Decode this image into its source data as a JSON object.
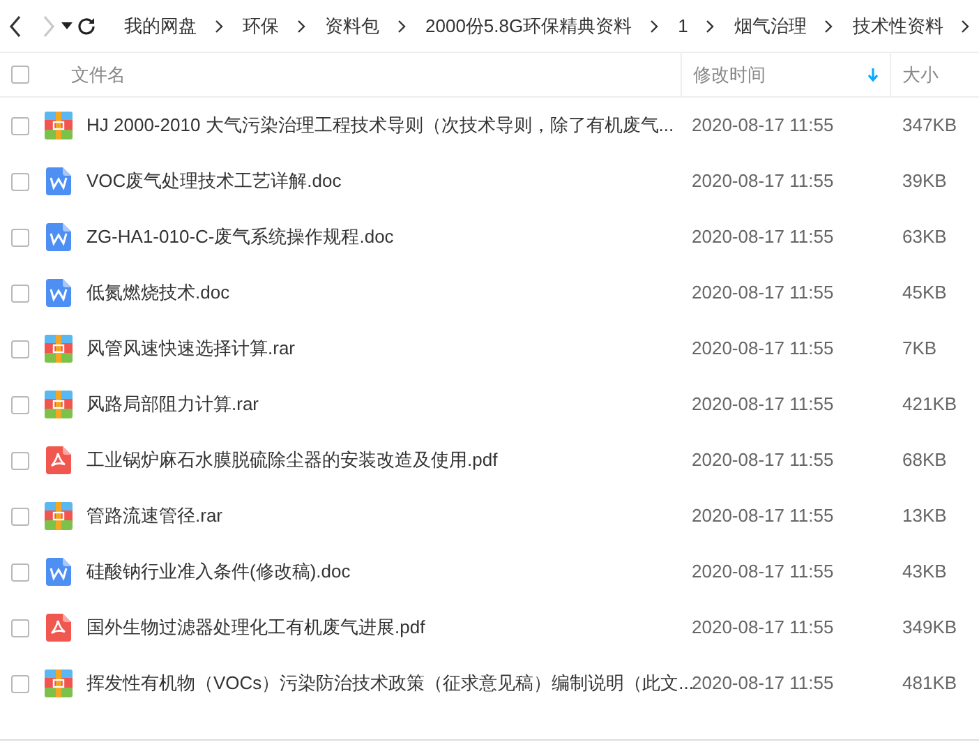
{
  "toolbar": {
    "back_enabled": true,
    "forward_enabled": false,
    "breadcrumb": [
      "我的网盘",
      "环保",
      "资料包",
      "2000份5.8G环保精典资料",
      "1",
      "烟气治理",
      "技术性资料"
    ]
  },
  "table": {
    "select_all_checked": false,
    "columns": [
      {
        "label": "文件名",
        "sorted": false
      },
      {
        "label": "修改时间",
        "sorted": true
      },
      {
        "label": "大小",
        "sorted": false
      }
    ],
    "rows": [
      {
        "kind": "rar",
        "name": "HJ 2000-2010 大气污染治理工程技术导则（次技术导则，除了有机废气...",
        "modified": "2020-08-17 11:55",
        "size": "347KB",
        "checked": false
      },
      {
        "kind": "doc",
        "name": "VOC废气处理技术工艺详解.doc",
        "modified": "2020-08-17 11:55",
        "size": "39KB",
        "checked": false
      },
      {
        "kind": "doc",
        "name": "ZG-HA1-010-C-废气系统操作规程.doc",
        "modified": "2020-08-17 11:55",
        "size": "63KB",
        "checked": false
      },
      {
        "kind": "doc",
        "name": "低氮燃烧技术.doc",
        "modified": "2020-08-17 11:55",
        "size": "45KB",
        "checked": false
      },
      {
        "kind": "rar",
        "name": "风管风速快速选择计算.rar",
        "modified": "2020-08-17 11:55",
        "size": "7KB",
        "checked": false
      },
      {
        "kind": "rar",
        "name": "风路局部阻力计算.rar",
        "modified": "2020-08-17 11:55",
        "size": "421KB",
        "checked": false
      },
      {
        "kind": "pdf",
        "name": "工业锅炉麻石水膜脱硫除尘器的安装改造及使用.pdf",
        "modified": "2020-08-17 11:55",
        "size": "68KB",
        "checked": false
      },
      {
        "kind": "rar",
        "name": "管路流速管径.rar",
        "modified": "2020-08-17 11:55",
        "size": "13KB",
        "checked": false
      },
      {
        "kind": "doc",
        "name": "硅酸钠行业准入条件(修改稿).doc",
        "modified": "2020-08-17 11:55",
        "size": "43KB",
        "checked": false
      },
      {
        "kind": "pdf",
        "name": "国外生物过滤器处理化工有机废气进展.pdf",
        "modified": "2020-08-17 11:55",
        "size": "349KB",
        "checked": false
      },
      {
        "kind": "rar",
        "name": "挥发性有机物（VOCs）污染防治技术政策（征求意见稿）编制说明（此文...",
        "modified": "2020-08-17 11:55",
        "size": "481KB",
        "checked": false
      }
    ]
  }
}
